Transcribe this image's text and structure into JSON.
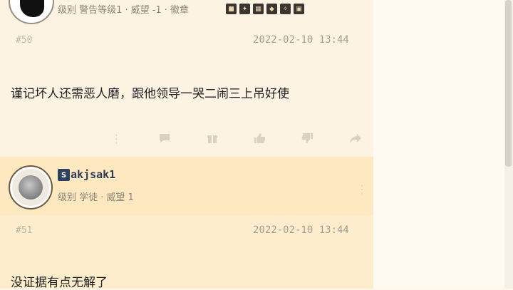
{
  "post1": {
    "meta_level_label": "级别",
    "meta_level_value": "警告等级1",
    "meta_prestige": "威望 -1",
    "meta_medal_label": "徽章",
    "badges": [
      "■",
      "✦",
      "▦",
      "◆",
      "✧",
      "▣"
    ],
    "floor": "#50",
    "time": "2022-02-10 13:44",
    "content": "谨记坏人还需恶人磨，跟他领导一哭二闹三上吊好使"
  },
  "post2": {
    "username_initial": "s",
    "username_rest": "akjsak1",
    "meta_level_label": "级别",
    "meta_level_value": "学徒",
    "meta_prestige": "威望 1",
    "floor": "#51",
    "time": "2022-02-10 13:44",
    "content": "没证据有点无解了"
  },
  "colors": {
    "accent": "#2d4160",
    "muted": "#a59e90",
    "post_bg": "#fdf3e3",
    "post2_bg": "#fde8c0"
  }
}
